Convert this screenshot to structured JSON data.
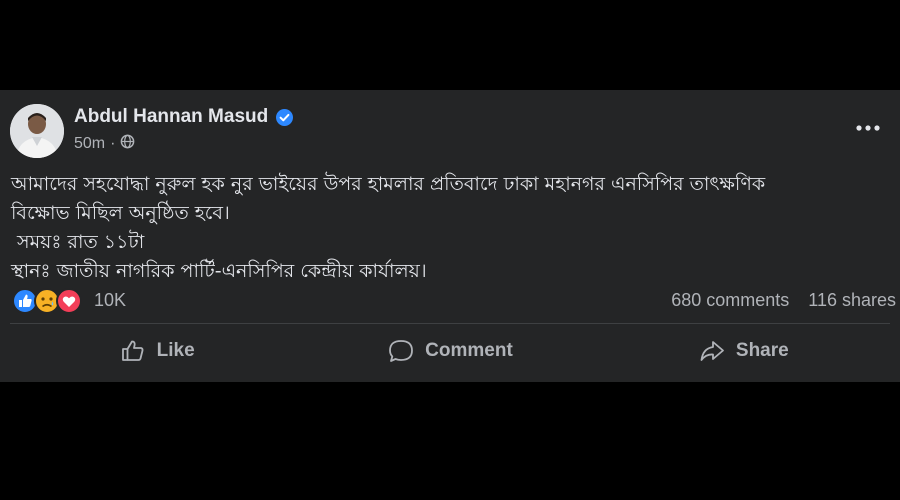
{
  "post": {
    "author": {
      "name": "Abdul Hannan Masud",
      "verified": true,
      "avatar_icon": "profile-photo"
    },
    "meta": {
      "time": "50m",
      "separator": "·",
      "privacy_icon": "globe-icon"
    },
    "more_icon": "more-options-icon",
    "body": [
      "আমাদের সহযোদ্ধা নুরুল হক নুর ভাইয়ের উপর হামলার প্রতিবাদে ঢাকা মহানগর এনসিপির তাৎক্ষণিক",
      "বিক্ষোভ মিছিল অনুষ্ঠিত হবে।",
      " সময়ঃ রাত ১১টা",
      "স্থানঃ জাতীয় নাগরিক পার্টি-এনসিপির কেন্দ্রীয় কার্যালয়।"
    ]
  },
  "reactions": {
    "icons": [
      "like-icon",
      "sad-icon",
      "love-icon"
    ],
    "count": "10K",
    "comments": "680 comments",
    "shares": "116 shares"
  },
  "actions": {
    "like": "Like",
    "comment": "Comment",
    "share": "Share"
  },
  "colors": {
    "page_bg": "#000000",
    "card_bg": "#242526",
    "text_primary": "#e4e6eb",
    "text_secondary": "#b0b3b8",
    "accent_blue": "#2d88ff",
    "love_red": "#f33e58",
    "sad_yellow": "#f7b125"
  }
}
